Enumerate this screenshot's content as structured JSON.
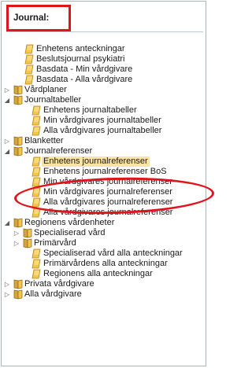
{
  "header": {
    "label": "Journal:"
  },
  "tree": [
    {
      "label": "Enhetens anteckningar",
      "kind": "doc",
      "depth": 1,
      "arrow": ""
    },
    {
      "label": "Beslutsjournal psykiatri",
      "kind": "doc",
      "depth": 1,
      "arrow": ""
    },
    {
      "label": "Basdata - Min vårdgivare",
      "kind": "doc",
      "depth": 1,
      "arrow": ""
    },
    {
      "label": "Basdata - Alla vårdgivare",
      "kind": "doc",
      "depth": 1,
      "arrow": ""
    },
    {
      "label": "Vårdplaner",
      "kind": "book",
      "depth": 1,
      "arrow": "collapsed"
    },
    {
      "label": "Journaltabeller",
      "kind": "book",
      "depth": 1,
      "arrow": "expanded"
    },
    {
      "label": "Enhetens journaltabeller",
      "kind": "doc",
      "depth": 2,
      "arrow": ""
    },
    {
      "label": "Min vårdgivares journaltabeller",
      "kind": "doc",
      "depth": 2,
      "arrow": ""
    },
    {
      "label": "Alla vårdgivares journaltabeller",
      "kind": "doc",
      "depth": 2,
      "arrow": ""
    },
    {
      "label": "Blanketter",
      "kind": "book",
      "depth": 1,
      "arrow": "collapsed"
    },
    {
      "label": "Journalreferenser",
      "kind": "book",
      "depth": 1,
      "arrow": "expanded"
    },
    {
      "label": "Enhetens journalreferenser",
      "kind": "doc",
      "depth": 2,
      "arrow": "",
      "selected": true
    },
    {
      "label": "Enhetens journalreferenser BoS",
      "kind": "doc",
      "depth": 2,
      "arrow": ""
    },
    {
      "label": "Min vårdgivares journalreferenser",
      "kind": "doc",
      "depth": 2,
      "arrow": ""
    },
    {
      "label": "Min vårdgivares journalreferenser",
      "kind": "doc",
      "depth": 2,
      "arrow": ""
    },
    {
      "label": "Alla vårdgivares journalreferenser",
      "kind": "doc",
      "depth": 2,
      "arrow": ""
    },
    {
      "label": "Alla vårdgivares journalreferenser",
      "kind": "doc",
      "depth": 2,
      "arrow": ""
    },
    {
      "label": "Regionens vårdenheter",
      "kind": "book",
      "depth": 1,
      "arrow": "expanded"
    },
    {
      "label": "Specialiserad vård",
      "kind": "book",
      "depth": 2,
      "arrow": "collapsed"
    },
    {
      "label": "Primärvård",
      "kind": "book",
      "depth": 2,
      "arrow": "collapsed"
    },
    {
      "label": "Specialiserad vård alla anteckningar",
      "kind": "doc",
      "depth": 2,
      "arrow": ""
    },
    {
      "label": "Primärvårdens alla anteckningar",
      "kind": "doc",
      "depth": 2,
      "arrow": ""
    },
    {
      "label": "Regionens alla anteckningar",
      "kind": "doc",
      "depth": 2,
      "arrow": ""
    },
    {
      "label": "Privata vårdgivare",
      "kind": "book",
      "depth": 1,
      "arrow": "collapsed"
    },
    {
      "label": "Alla vårdgivare",
      "kind": "book",
      "depth": 1,
      "arrow": "collapsed"
    }
  ],
  "colors": {
    "annotation_red": "#e0141c",
    "selected_bg": "#fbe3a1",
    "folder_yellow": "#f3c54a"
  }
}
